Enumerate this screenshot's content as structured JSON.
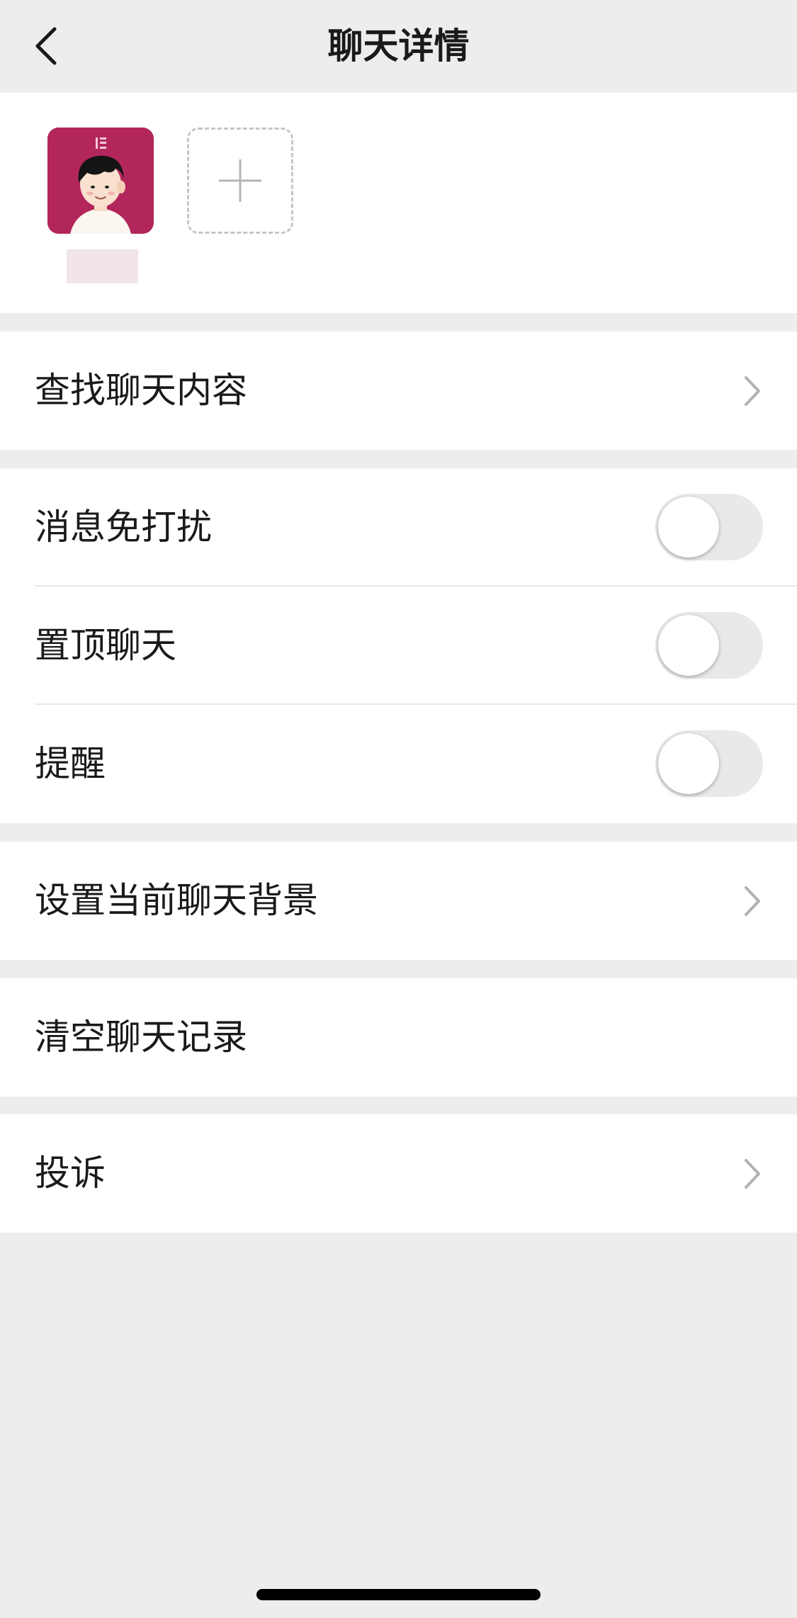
{
  "header": {
    "title": "聊天详情"
  },
  "members": {
    "items": [
      {
        "name": ""
      }
    ]
  },
  "menu": {
    "search_chat": "查找聊天内容",
    "mute_notifications": "消息免打扰",
    "mute_notifications_on": false,
    "sticky_chat": "置顶聊天",
    "sticky_chat_on": false,
    "remind": "提醒",
    "remind_on": false,
    "set_background": "设置当前聊天背景",
    "clear_history": "清空聊天记录",
    "report": "投诉"
  },
  "colors": {
    "background": "#ededed",
    "avatar_bg": "#b3265c",
    "toggle_off": "#e9e9ea"
  }
}
